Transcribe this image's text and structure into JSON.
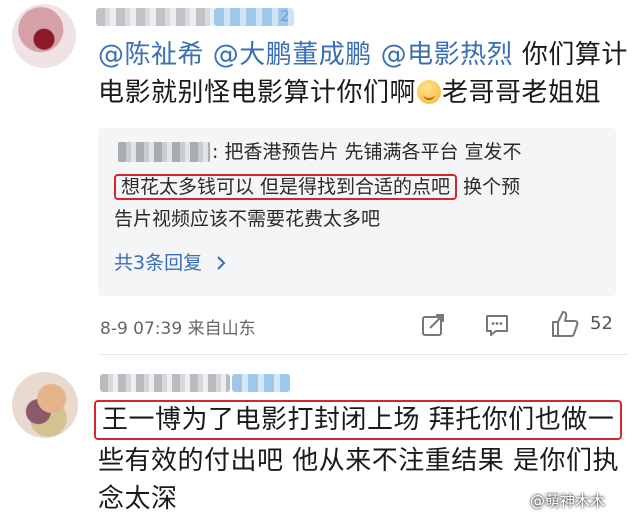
{
  "comment1": {
    "badge_number": "2",
    "mentions": [
      "@陈祉希",
      "@大鹏董成鹏",
      "@电影热烈"
    ],
    "text_line1_tail": "你们算计",
    "text_line2_a": "电影就别怪电影算计你们啊",
    "text_line2_b": "老哥哥老姐姐",
    "reply": {
      "line1": ": 把香港预告片 先铺满各平台 宣发不",
      "line2_highlight": "想花太多钱可以 但是得找到合适的点吧",
      "line2_tail": "换个预",
      "line3": "告片视频应该不需要花费太多吧",
      "more_label": "共3条回复",
      "more_icon": "chevron-right-icon"
    },
    "meta": "8-9 07:39 来自山东",
    "actions": {
      "share_icon": "share-icon",
      "comment_icon": "comment-icon",
      "like_icon": "thumbs-up-icon",
      "like_count": "52"
    }
  },
  "comment2": {
    "line1_highlight": "王一博为了电影打封闭上场 拜托你们也做一",
    "line2": "些有效的付出吧 他从来不注重结果 是你们执",
    "line3": "念太深"
  },
  "watermark": "@萌神木木",
  "colors": {
    "link": "#3a6fb5",
    "highlight_border": "#d6262b",
    "reply_bg": "#f4f5f7"
  }
}
